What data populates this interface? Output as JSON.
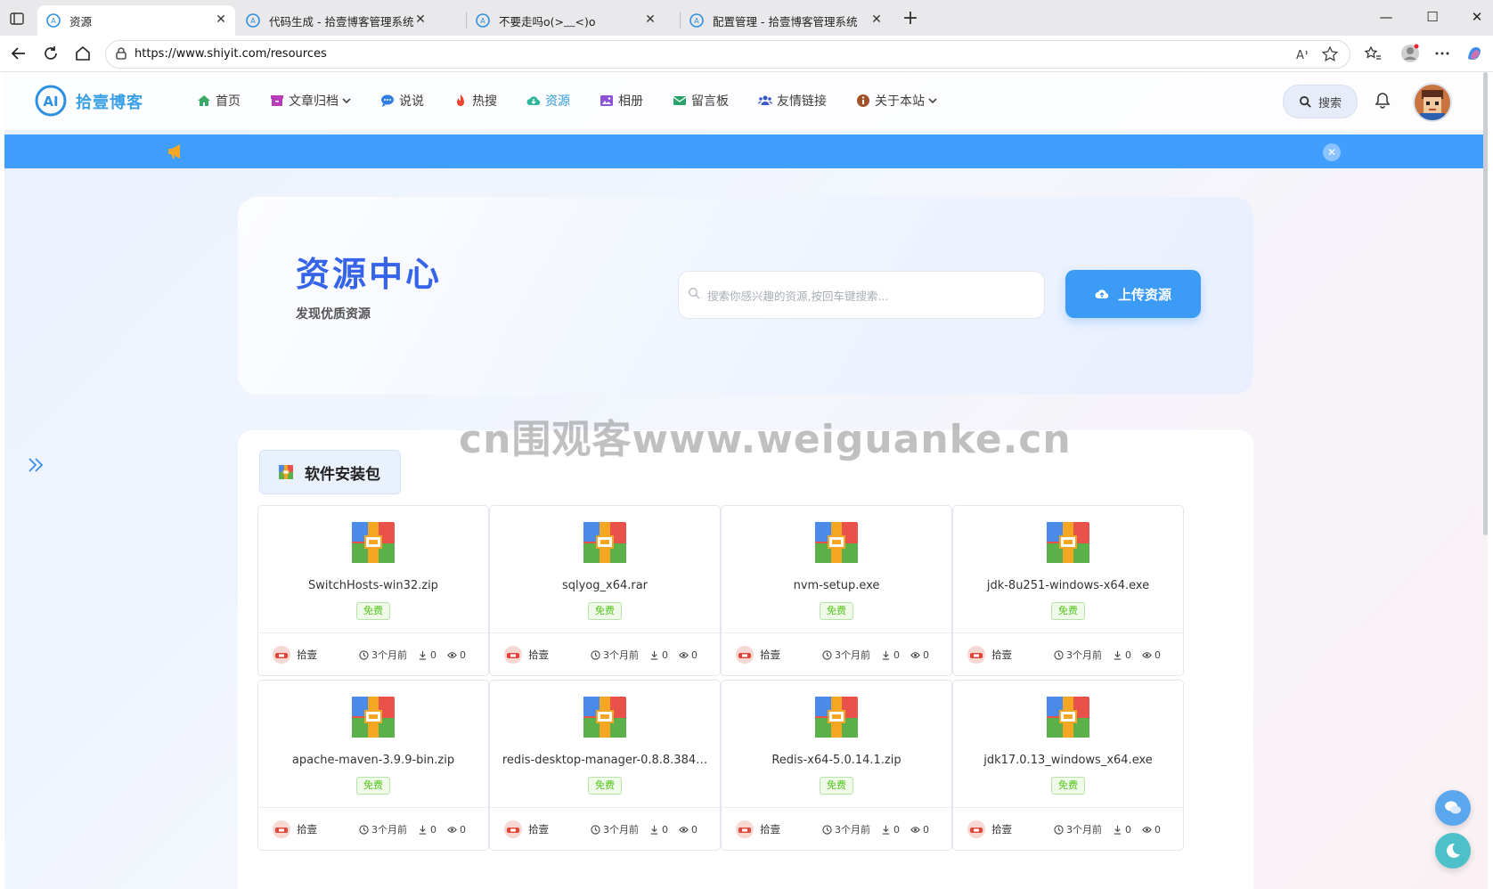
{
  "browser": {
    "tabs": [
      {
        "title": "资源",
        "active": true
      },
      {
        "title": "代码生成 - 拾壹博客管理系统",
        "active": false
      },
      {
        "title": "不要走吗o(>﹏<)o",
        "active": false
      },
      {
        "title": "配置管理 - 拾壹博客管理系统",
        "active": false
      }
    ],
    "url": "https://www.shiyit.com/resources",
    "window_controls": [
      "minimize",
      "maximize",
      "close"
    ]
  },
  "site": {
    "logo_text": "拾壹博客",
    "nav": [
      {
        "label": "首页",
        "icon": "home-icon",
        "color": "#3aa866"
      },
      {
        "label": "文章归档",
        "icon": "archive-icon",
        "color": "#b83db8",
        "dropdown": true
      },
      {
        "label": "说说",
        "icon": "chat-icon",
        "color": "#2f7fe0"
      },
      {
        "label": "热搜",
        "icon": "fire-icon",
        "color": "#f0432b"
      },
      {
        "label": "资源",
        "icon": "cloud-download-icon",
        "color": "#2fb59b",
        "active": true
      },
      {
        "label": "相册",
        "icon": "photo-icon",
        "color": "#8b54d6"
      },
      {
        "label": "留言板",
        "icon": "envelope-icon",
        "color": "#2aa36b"
      },
      {
        "label": "友情链接",
        "icon": "users-icon",
        "color": "#3a57c8"
      },
      {
        "label": "关于本站",
        "icon": "info-icon",
        "color": "#a0522d",
        "dropdown": true
      }
    ],
    "search_label": "搜索"
  },
  "hero": {
    "title": "资源中心",
    "subtitle": "发现优质资源",
    "search_placeholder": "搜索你感兴趣的资源,按回车键搜索...",
    "upload_label": "上传资源"
  },
  "watermark": "cn围观客www.weiguanke.cn",
  "category": {
    "label": "软件安装包"
  },
  "resources": [
    {
      "name": "SwitchHosts-win32.zip",
      "badge": "免费",
      "user": "拾壹",
      "time": "3个月前",
      "downloads": "0",
      "views": "0"
    },
    {
      "name": "sqlyog_x64.rar",
      "badge": "免费",
      "user": "拾壹",
      "time": "3个月前",
      "downloads": "0",
      "views": "0"
    },
    {
      "name": "nvm-setup.exe",
      "badge": "免费",
      "user": "拾壹",
      "time": "3个月前",
      "downloads": "0",
      "views": "0"
    },
    {
      "name": "jdk-8u251-windows-x64.exe",
      "badge": "免费",
      "user": "拾壹",
      "time": "3个月前",
      "downloads": "0",
      "views": "0"
    },
    {
      "name": "apache-maven-3.9.9-bin.zip",
      "badge": "免费",
      "user": "拾壹",
      "time": "3个月前",
      "downloads": "0",
      "views": "0"
    },
    {
      "name": "redis-desktop-manager-0.8.8.384…",
      "badge": "免费",
      "user": "拾壹",
      "time": "3个月前",
      "downloads": "0",
      "views": "0"
    },
    {
      "name": "Redis-x64-5.0.14.1.zip",
      "badge": "免费",
      "user": "拾壹",
      "time": "3个月前",
      "downloads": "0",
      "views": "0"
    },
    {
      "name": "jdk17.0.13_windows_x64.exe",
      "badge": "免费",
      "user": "拾壹",
      "time": "3个月前",
      "downloads": "0",
      "views": "0"
    }
  ],
  "colors": {
    "accent": "#409eff",
    "hero_title": "#3563e9",
    "free_badge": "#52c41a"
  }
}
